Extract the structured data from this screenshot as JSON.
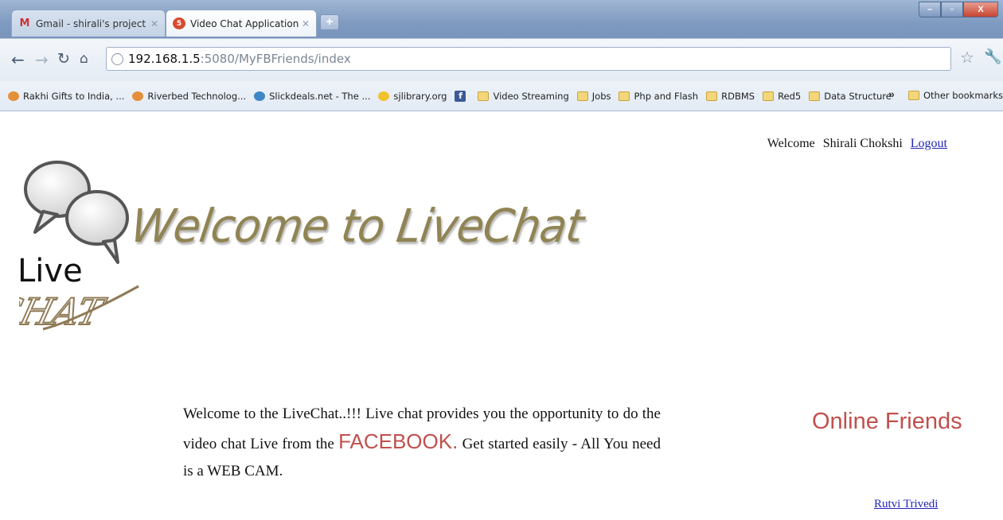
{
  "browser": {
    "tabs": [
      {
        "title": "Gmail - shirali's project - ...",
        "icon": "gmail-icon",
        "active": false
      },
      {
        "title": "Video Chat Application",
        "icon": "html5-icon",
        "active": true
      }
    ],
    "new_tab_label": "+",
    "window_buttons": {
      "minimize": "–",
      "maximize": "▫",
      "close": "X"
    },
    "address": {
      "host": "192.168.1.5",
      "path": ":5080/MyFBFriends/index"
    },
    "bookmarks": [
      {
        "label": "Rakhi Gifts to India, ...",
        "icon": "gift-icon"
      },
      {
        "label": "Riverbed Technolog...",
        "icon": "riverbed-icon"
      },
      {
        "label": "Slickdeals.net - The ...",
        "icon": "slickdeals-icon"
      },
      {
        "label": "sjlibrary.org",
        "icon": "library-icon"
      },
      {
        "label": "",
        "icon": "facebook-icon"
      },
      {
        "label": "Video Streaming",
        "icon": "folder-icon"
      },
      {
        "label": "Jobs",
        "icon": "folder-icon"
      },
      {
        "label": "Php and Flash",
        "icon": "folder-icon"
      },
      {
        "label": "RDBMS",
        "icon": "folder-icon"
      },
      {
        "label": "Red5",
        "icon": "folder-icon"
      },
      {
        "label": "Data Structure",
        "icon": "folder-icon"
      }
    ],
    "overflow_chevron": "»",
    "other_bookmarks": "Other bookmarks"
  },
  "page": {
    "welcome_label": "Welcome",
    "user_name": "Shirali Chokshi",
    "logout_label": "Logout",
    "logo_text": {
      "live": "Live",
      "chat": "CHAT"
    },
    "hero_title": "Welcome to LiveChat",
    "intro": {
      "part1": "Welcome to the LiveChat..!!! Live chat provides you the opportunity to do the video chat Live from the ",
      "highlight": "FACEBOOK.",
      "part2": " Get started easily - All You need is a WEB CAM."
    },
    "online_friends_heading": "Online Friends",
    "friends": [
      "Rutvi Trivedi"
    ],
    "colors": {
      "accent": "#c0504d",
      "link": "#2226b8",
      "title": "#908454"
    }
  }
}
